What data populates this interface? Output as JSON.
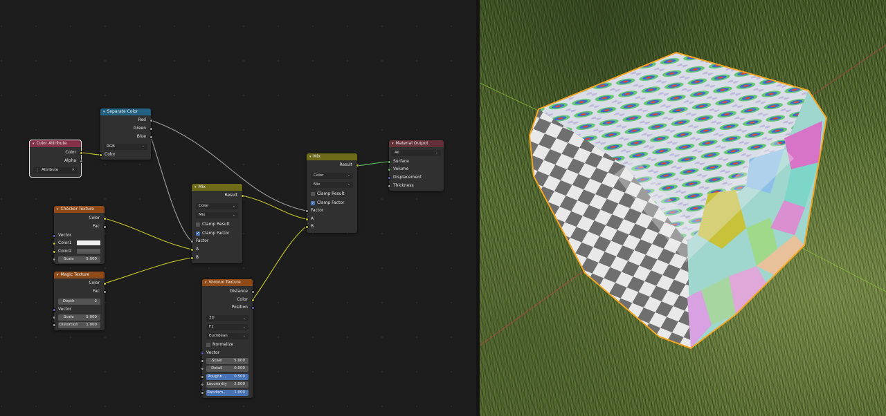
{
  "nodes": {
    "color_attribute": {
      "title": "Color Attribute",
      "out_color": "Color",
      "out_alpha": "Alpha",
      "attribute_name": "Attribute"
    },
    "separate_color": {
      "title": "Separate Color",
      "out_red": "Red",
      "out_green": "Green",
      "out_blue": "Blue",
      "mode": "RGB",
      "in_color": "Color"
    },
    "mix1": {
      "title": "Mix",
      "out_result": "Result",
      "data_type": "Color",
      "blend": "Mix",
      "clamp_result": "Clamp Result",
      "clamp_factor": "Clamp Factor",
      "in_factor": "Factor",
      "in_a": "A",
      "in_b": "B"
    },
    "mix2": {
      "title": "Mix",
      "out_result": "Result",
      "data_type": "Color",
      "blend": "Mix",
      "clamp_result": "Clamp Result",
      "clamp_factor": "Clamp Factor",
      "in_factor": "Factor",
      "in_a": "A",
      "in_b": "B"
    },
    "material_output": {
      "title": "Material Output",
      "target": "All",
      "in_surface": "Surface",
      "in_volume": "Volume",
      "in_displacement": "Displacement",
      "in_thickness": "Thickness"
    },
    "checker": {
      "title": "Checker Texture",
      "out_color": "Color",
      "out_fac": "Fac",
      "in_vector": "Vector",
      "in_color1": "Color1",
      "in_color2": "Color2",
      "scale_label": "Scale",
      "scale_value": "5.000"
    },
    "magic": {
      "title": "Magic Texture",
      "out_color": "Color",
      "out_fac": "Fac",
      "depth_label": "Depth",
      "depth_value": "2",
      "in_vector": "Vector",
      "scale_label": "Scale",
      "scale_value": "5.000",
      "distortion_label": "Distortion",
      "distortion_value": "1.000"
    },
    "voronoi": {
      "title": "Voronoi Texture",
      "out_distance": "Distance",
      "out_color": "Color",
      "out_position": "Position",
      "dimensions": "3D",
      "feature": "F1",
      "metric": "Euclidean",
      "normalize": "Normalize",
      "in_vector": "Vector",
      "scale_label": "Scale",
      "scale_value": "5.000",
      "detail_label": "Detail",
      "detail_value": "0.000",
      "roughness_label": "Roughn...",
      "roughness_value": "0.500",
      "lacunarity_label": "Lacunarity",
      "lacunarity_value": "2.000",
      "randomness_label": "Random...",
      "randomness_value": "1.000"
    }
  },
  "colors": {
    "header_input": "#83314a",
    "header_converter": "#246283",
    "header_color": "#6e6b18",
    "header_texture": "#8f4a17",
    "header_output": "#643038",
    "socket_color": "#c7c729",
    "socket_float": "#a1a1a1",
    "socket_vector": "#6363c7",
    "socket_shader": "#63c763",
    "selection_outline": "#f5a623"
  }
}
